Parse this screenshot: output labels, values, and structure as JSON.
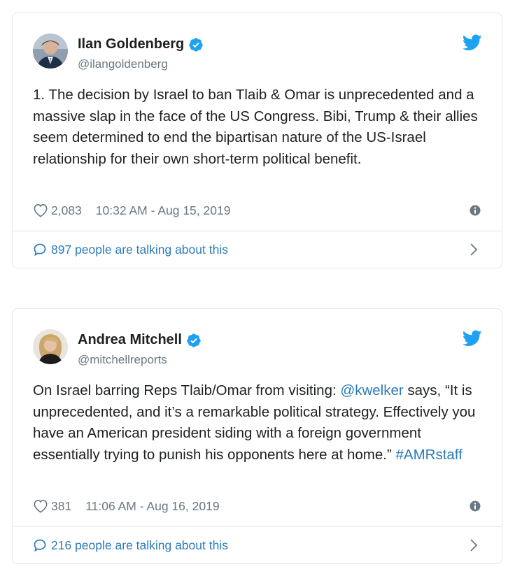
{
  "tweets": [
    {
      "author": "Ilan Goldenberg",
      "handle": "@ilangoldenberg",
      "text_parts": [
        {
          "text": "1. The decision by Israel to ban Tlaib & Omar is unprecedented and a massive slap in the face of the US Congress. Bibi, Trump & their allies seem determined to end the bipartisan nature of the US-Israel relationship for their own short-term political benefit.",
          "link": false
        }
      ],
      "likes": "2,083",
      "timestamp": "10:32 AM - Aug 15, 2019",
      "talking": "897 people are talking about this"
    },
    {
      "author": "Andrea Mitchell",
      "handle": "@mitchellreports",
      "text_parts": [
        {
          "text": "On Israel barring Reps Tlaib/Omar from visiting: ",
          "link": false
        },
        {
          "text": "@kwelker",
          "link": true
        },
        {
          "text": " says, “It is unprecedented, and it’s a remarkable political strategy. Effectively you have an American president siding with a foreign government essentially trying to punish his opponents here at home.” ",
          "link": false
        },
        {
          "text": "#AMRstaff",
          "link": true
        }
      ],
      "likes": "381",
      "timestamp": "11:06 AM - Aug 16, 2019",
      "talking": "216 people are talking about this"
    }
  ],
  "colors": {
    "link": "#2b7bb9",
    "twitter_blue": "#1da1f2",
    "muted": "#697882",
    "border": "#e1e8ed"
  },
  "icons": [
    "verified-badge-icon",
    "twitter-bird-icon",
    "heart-icon",
    "info-icon",
    "comment-bubble-icon",
    "chevron-right-icon"
  ]
}
